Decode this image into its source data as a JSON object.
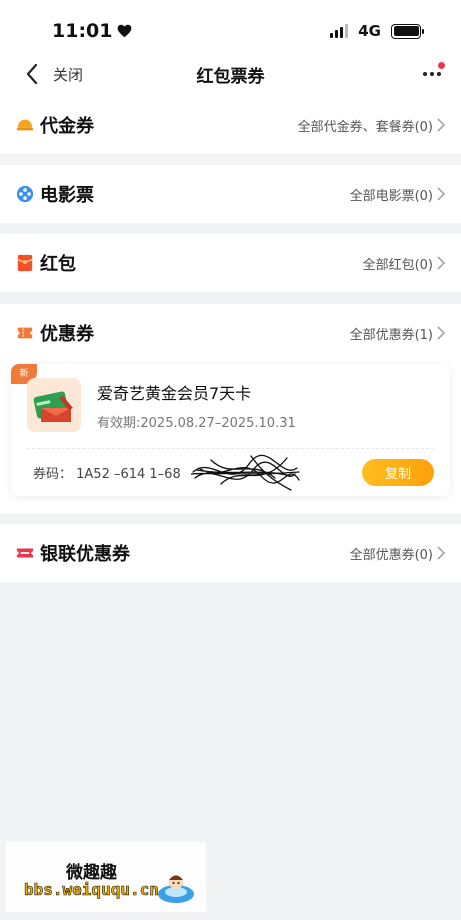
{
  "status_bar": {
    "time": "11:01",
    "network": "4G"
  },
  "nav": {
    "close_label": "关闭",
    "title": "红包票券"
  },
  "sections": [
    {
      "id": "voucher",
      "title": "代金券",
      "link": "全部代金券、套餐券(0)",
      "icon": "voucher-icon",
      "color": "#f5a623"
    },
    {
      "id": "movie",
      "title": "电影票",
      "link": "全部电影票(0)",
      "icon": "film-reel-icon",
      "color": "#3b8ef0"
    },
    {
      "id": "redpacket",
      "title": "红包",
      "link": "全部红包(0)",
      "icon": "red-packet-icon",
      "color": "#f0502e"
    },
    {
      "id": "coupon",
      "title": "优惠券",
      "link": "全部优惠券(1)",
      "icon": "coupon-icon",
      "color": "#f07a3a"
    },
    {
      "id": "unionpay",
      "title": "银联优惠券",
      "link": "全部优惠券(0)",
      "icon": "unionpay-ticket-icon",
      "color": "#e8374f"
    }
  ],
  "coupon_card": {
    "corner_tag": "新",
    "name": "爱奇艺黄金会员7天卡",
    "validity": "有效期:2025.08.27–2025.10.31",
    "code": "券码： 1A52 –614 1–68",
    "copy_label": "复制"
  },
  "watermark": {
    "cn": "微趣趣",
    "url": "bbs.weiququ.cn"
  }
}
